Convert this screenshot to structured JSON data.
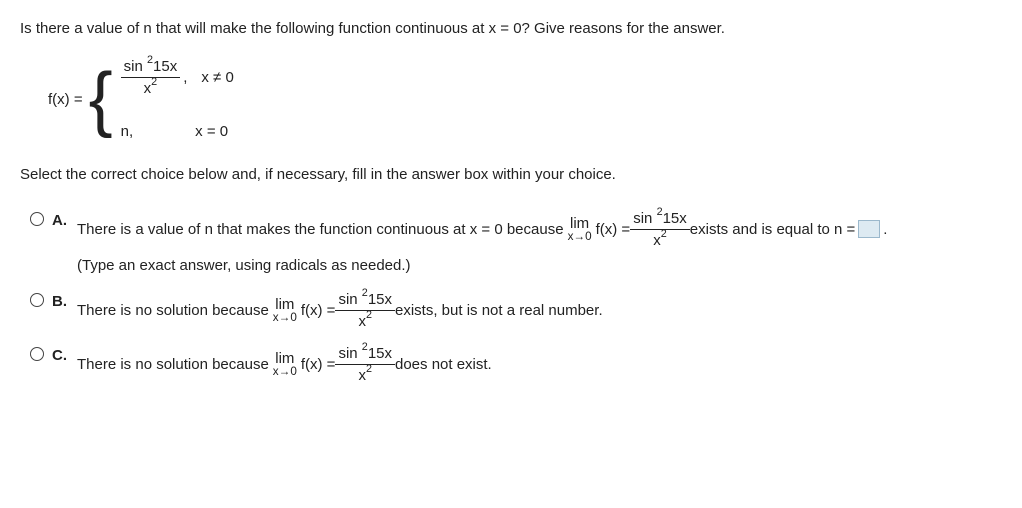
{
  "question": "Is there a value of n that will make the following function continuous at x = 0? Give reasons for the answer.",
  "func": {
    "lhs": "f(x) =",
    "case1_num_a": "sin",
    "case1_num_exp": "2",
    "case1_num_b": "15x",
    "case1_den_a": "x",
    "case1_den_exp": "2",
    "case1_sep": ",",
    "case1_cond": "x ≠ 0",
    "case2_val": "n,",
    "case2_cond": "x = 0"
  },
  "instruction": "Select the correct choice below and, if necessary, fill in the answer box within your choice.",
  "choices": {
    "A": {
      "label": "A.",
      "pre": "There is a value of n that makes the function continuous at x = 0 because ",
      "lim_top": "lim",
      "lim_bot": "x→0",
      "fx": " f(x) = ",
      "frac_num_a": "sin",
      "frac_num_exp": "2",
      "frac_num_b": "15x",
      "frac_den_a": "x",
      "frac_den_exp": "2",
      "post": " exists and is equal to n = ",
      "period": ".",
      "hint": "(Type an exact answer, using radicals as needed.)"
    },
    "B": {
      "label": "B.",
      "pre": "There is no solution because ",
      "lim_top": "lim",
      "lim_bot": "x→0",
      "fx": " f(x) = ",
      "frac_num_a": "sin",
      "frac_num_exp": "2",
      "frac_num_b": "15x",
      "frac_den_a": "x",
      "frac_den_exp": "2",
      "post": " exists, but is not a real number."
    },
    "C": {
      "label": "C.",
      "pre": "There is no solution because ",
      "lim_top": "lim",
      "lim_bot": "x→0",
      "fx": " f(x) = ",
      "frac_num_a": "sin",
      "frac_num_exp": "2",
      "frac_num_b": "15x",
      "frac_den_a": "x",
      "frac_den_exp": "2",
      "post": " does not exist."
    }
  }
}
